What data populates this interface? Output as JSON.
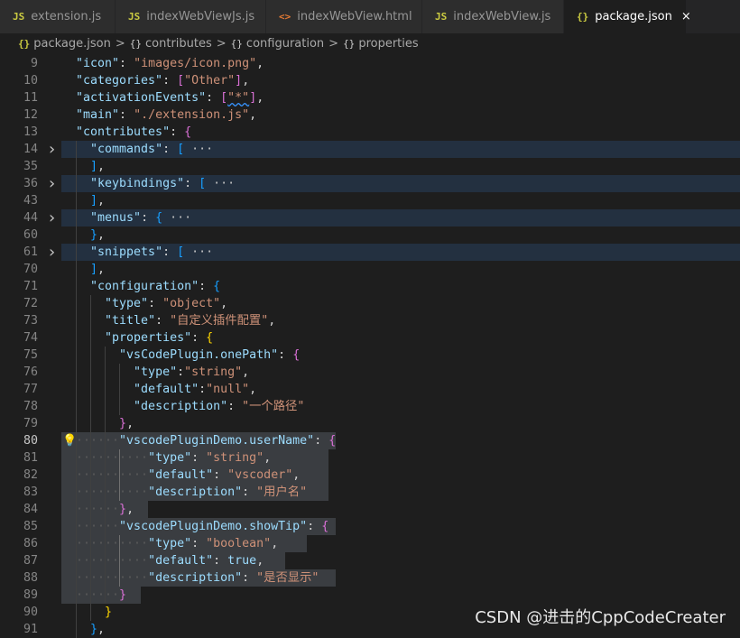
{
  "tabs": [
    {
      "icon": "JS",
      "label": "extension.js",
      "type": "js",
      "active": false
    },
    {
      "icon": "JS",
      "label": "indexWebViewJs.js",
      "type": "js",
      "active": false
    },
    {
      "icon": "<>",
      "label": "indexWebView.html",
      "type": "html",
      "active": false
    },
    {
      "icon": "JS",
      "label": "indexWebView.js",
      "type": "js",
      "active": false
    },
    {
      "icon": "{}",
      "label": "package.json",
      "type": "json",
      "active": true
    }
  ],
  "close_icon": "×",
  "breadcrumb": {
    "file": "package.json",
    "items": [
      "contributes",
      "configuration",
      "properties"
    ],
    "separator": ">"
  },
  "lines": [
    {
      "n": "9",
      "text": "\"icon\": \"images/icon.png\","
    },
    {
      "n": "10",
      "text": "\"categories\": [\"Other\"],"
    },
    {
      "n": "11",
      "text": "\"activationEvents\": [\"*\"],"
    },
    {
      "n": "12",
      "text": "\"main\": \"./extension.js\","
    },
    {
      "n": "13",
      "text": "\"contributes\": {"
    },
    {
      "n": "14",
      "text": "\"commands\": [ ···"
    },
    {
      "n": "35",
      "text": "],"
    },
    {
      "n": "36",
      "text": "\"keybindings\": [ ···"
    },
    {
      "n": "43",
      "text": "],"
    },
    {
      "n": "44",
      "text": "\"menus\": { ···"
    },
    {
      "n": "60",
      "text": "},"
    },
    {
      "n": "61",
      "text": "\"snippets\": [ ···"
    },
    {
      "n": "70",
      "text": "],"
    },
    {
      "n": "71",
      "text": "\"configuration\": {"
    },
    {
      "n": "72",
      "text": "\"type\": \"object\","
    },
    {
      "n": "73",
      "text": "\"title\": \"自定义插件配置\","
    },
    {
      "n": "74",
      "text": "\"properties\": {"
    },
    {
      "n": "75",
      "text": "\"vsCodePlugin.onePath\": {"
    },
    {
      "n": "76",
      "text": "\"type\":\"string\","
    },
    {
      "n": "77",
      "text": "\"default\":\"null\","
    },
    {
      "n": "78",
      "text": "\"description\": \"一个路径\""
    },
    {
      "n": "79",
      "text": "},"
    },
    {
      "n": "80",
      "text": "\"vscodePluginDemo.userName\": {"
    },
    {
      "n": "81",
      "text": "\"type\": \"string\","
    },
    {
      "n": "82",
      "text": "\"default\": \"vscoder\","
    },
    {
      "n": "83",
      "text": "\"description\": \"用户名\""
    },
    {
      "n": "84",
      "text": "},"
    },
    {
      "n": "85",
      "text": "\"vscodePluginDemo.showTip\": {"
    },
    {
      "n": "86",
      "text": "\"type\": \"boolean\","
    },
    {
      "n": "87",
      "text": "\"default\": true,"
    },
    {
      "n": "88",
      "text": "\"description\": \"是否显示\""
    },
    {
      "n": "89",
      "text": "}"
    },
    {
      "n": "90",
      "text": "}"
    },
    {
      "n": "91",
      "text": "},"
    }
  ],
  "current_line": "80",
  "watermark": "CSDN @进击的CppCodeCreater",
  "colors": {
    "background": "#1e1e1e",
    "key": "#9cdcfe",
    "string": "#ce9178",
    "bracket_gold": "#ffd700",
    "bracket_purple": "#da70d6",
    "bracket_blue": "#179fff",
    "selection": "#3a3d41"
  },
  "icons": {
    "fold_chevron": "chevron-right-icon",
    "lightbulb": "lightbulb-icon"
  }
}
